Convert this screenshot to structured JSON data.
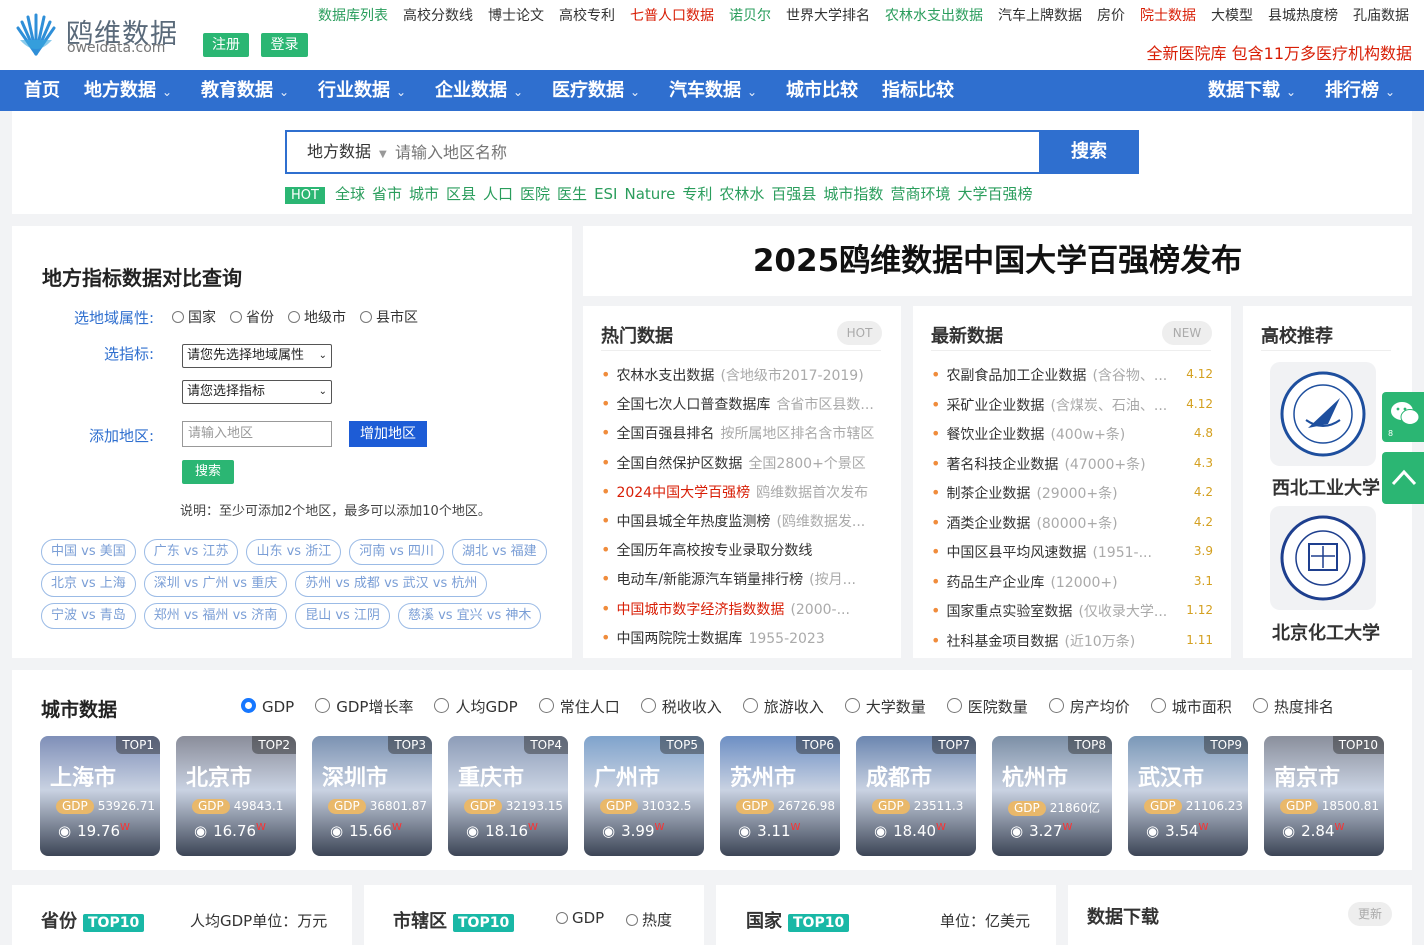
{
  "header": {
    "logo_cn": "鸥维数据",
    "logo_en": "oweidata.com",
    "register": "注册",
    "login": "登录",
    "links": [
      {
        "label": "数据库列表",
        "color": "green"
      },
      {
        "label": "高校分数线",
        "color": "normal"
      },
      {
        "label": "博士论文",
        "color": "normal"
      },
      {
        "label": "高校专利",
        "color": "normal"
      },
      {
        "label": "七普人口数据",
        "color": "red"
      },
      {
        "label": "诺贝尔",
        "color": "green"
      },
      {
        "label": "世界大学排名",
        "color": "normal"
      },
      {
        "label": "农林水支出数据",
        "color": "green"
      },
      {
        "label": "汽车上牌数据",
        "color": "normal"
      },
      {
        "label": "房价",
        "color": "normal"
      },
      {
        "label": "院士数据",
        "color": "red"
      },
      {
        "label": "大模型",
        "color": "normal"
      },
      {
        "label": "县城热度榜",
        "color": "normal"
      },
      {
        "label": "孔庙数据",
        "color": "normal"
      }
    ],
    "promo": "全新医院库 包含11万多医疗机构数据"
  },
  "nav": {
    "items": [
      "首页",
      "地方数据",
      "教育数据",
      "行业数据",
      "企业数据",
      "医疗数据",
      "汽车数据",
      "城市比较",
      "指标比较"
    ],
    "right_items": [
      "数据下载",
      "排行榜"
    ]
  },
  "search": {
    "category": "地方数据",
    "placeholder": "请输入地区名称",
    "button": "搜索",
    "hot_label": "HOT",
    "hot_links": [
      "全球",
      "省市",
      "城市",
      "区县",
      "人口",
      "医院",
      "医生",
      "ESI",
      "Nature",
      "专利",
      "农林水",
      "百强县",
      "城市指数",
      "营商环境",
      "大学百强榜"
    ]
  },
  "compare": {
    "title": "地方指标数据对比查询",
    "region_label": "选地域属性:",
    "region_options": [
      "国家",
      "省份",
      "地级市",
      "县市区"
    ],
    "indicator_label": "选指标:",
    "indicator_select1": "请您先选择地域属性",
    "indicator_select2": "请您选择指标",
    "add_label": "添加地区:",
    "add_placeholder": "请输入地区",
    "add_button": "增加地区",
    "search_button": "搜索",
    "note": "说明：至少可添加2个地区，最多可以添加10个地区。",
    "pills": [
      [
        "中国 vs 美国",
        "广东 vs 江苏",
        "山东 vs 浙江",
        "河南 vs 四川",
        "湖北 vs 福建"
      ],
      [
        "北京 vs 上海",
        "深圳 vs 广州 vs 重庆",
        "苏州 vs 成都 vs 武汉 vs 杭州"
      ],
      [
        "宁波 vs 青岛",
        "郑州 vs 福州 vs 济南",
        "昆山 vs 江阴",
        "慈溪 vs 宜兴 vs 神木"
      ]
    ]
  },
  "banner": {
    "text": "2025鸥维数据中国大学百强榜发布"
  },
  "hot_data": {
    "title": "热门数据",
    "badge": "HOT",
    "items": [
      {
        "t": "农林水支出数据",
        "sub": "(含地级市2017-2019)",
        "red": false
      },
      {
        "t": "全国七次人口普查数据库",
        "sub": "含省市区县数...",
        "red": false
      },
      {
        "t": "全国百强县排名",
        "sub": "按所属地区排名含市辖区",
        "red": false
      },
      {
        "t": "全国自然保护区数据",
        "sub": "全国2800+个景区",
        "red": false
      },
      {
        "t": "2024中国大学百强榜",
        "sub": "鸥维数据首次发布",
        "red": true
      },
      {
        "t": "中国县城全年热度监测榜",
        "sub": "(鸥维数据发...",
        "red": false
      },
      {
        "t": "全国历年高校按专业录取分数线",
        "sub": "",
        "red": false
      },
      {
        "t": "电动车/新能源汽车销量排行榜",
        "sub": "(按月...",
        "red": false
      },
      {
        "t": "中国城市数字经济指数数据",
        "sub": "(2000-...",
        "red": true
      },
      {
        "t": "中国两院院士数据库",
        "sub": "1955-2023",
        "red": false
      }
    ]
  },
  "new_data": {
    "title": "最新数据",
    "badge": "NEW",
    "items": [
      {
        "t": "农副食品加工企业数据",
        "sub": "(含谷物、...",
        "d": "4.12"
      },
      {
        "t": "采矿业企业数据",
        "sub": "(含煤炭、石油、...",
        "d": "4.12"
      },
      {
        "t": "餐饮业企业数据",
        "sub": "(400w+条)",
        "d": "4.8"
      },
      {
        "t": "著名科技企业数据",
        "sub": "(47000+条)",
        "d": "4.3"
      },
      {
        "t": "制茶企业数据",
        "sub": "(29000+条)",
        "d": "4.2"
      },
      {
        "t": "酒类企业数据",
        "sub": "(80000+条)",
        "d": "4.2"
      },
      {
        "t": "中国区县平均风速数据",
        "sub": "(1951-...",
        "d": "3.9"
      },
      {
        "t": "药品生产企业库",
        "sub": "(12000+)",
        "d": "3.1"
      },
      {
        "t": "国家重点实验室数据",
        "sub": "(仅收录大学...",
        "d": "1.12"
      },
      {
        "t": "社科基金项目数据",
        "sub": "(近10万条)",
        "d": "1.11"
      }
    ]
  },
  "universities": {
    "title": "高校推荐",
    "items": [
      "西北工业大学",
      "北京化工大学"
    ]
  },
  "city": {
    "title": "城市数据",
    "options": [
      "GDP",
      "GDP增长率",
      "人均GDP",
      "常住人口",
      "税收收入",
      "旅游收入",
      "大学数量",
      "医院数量",
      "房产均价",
      "城市面积",
      "热度排名"
    ],
    "selected": "GDP",
    "cards": [
      {
        "name": "上海市",
        "top": "TOP1",
        "gdp_label": "GDP",
        "gdp": "53926.71",
        "views": "19.76",
        "w": "W",
        "color": "#7f8fb8"
      },
      {
        "name": "北京市",
        "top": "TOP2",
        "gdp_label": "GDP",
        "gdp": "49843.1",
        "views": "16.76",
        "w": "W",
        "color": "#8a8d9a"
      },
      {
        "name": "深圳市",
        "top": "TOP3",
        "gdp_label": "GDP",
        "gdp": "36801.87",
        "views": "15.66",
        "w": "W",
        "color": "#7b92b2"
      },
      {
        "name": "重庆市",
        "top": "TOP4",
        "gdp_label": "GDP",
        "gdp": "32193.15",
        "views": "18.16",
        "w": "W",
        "color": "#8d9cb8"
      },
      {
        "name": "广州市",
        "top": "TOP5",
        "gdp_label": "GDP",
        "gdp": "31032.5",
        "views": "3.99",
        "w": "W",
        "color": "#7fa3cc"
      },
      {
        "name": "苏州市",
        "top": "TOP6",
        "gdp_label": "GDP",
        "gdp": "26726.98",
        "views": "3.11",
        "w": "W",
        "color": "#6d8fc4"
      },
      {
        "name": "成都市",
        "top": "TOP7",
        "gdp_label": "GDP",
        "gdp": "23511.3",
        "views": "18.40",
        "w": "W",
        "color": "#6b86b0"
      },
      {
        "name": "杭州市",
        "top": "TOP8",
        "gdp_label": "GDP",
        "gdp": "21860亿",
        "views": "3.27",
        "w": "W",
        "color": "#7c8fa6"
      },
      {
        "name": "武汉市",
        "top": "TOP9",
        "gdp_label": "GDP",
        "gdp": "21106.23",
        "views": "3.54",
        "w": "W",
        "color": "#7a98b8"
      },
      {
        "name": "南京市",
        "top": "TOP10",
        "gdp_label": "GDP",
        "gdp": "18500.81",
        "views": "2.84",
        "w": "W",
        "color": "#8a8f9c"
      }
    ]
  },
  "bottom": {
    "province_title": "省份",
    "province_badge": "TOP10",
    "province_unit": "人均GDP单位：万元",
    "district_title": "市辖区",
    "district_badge": "TOP10",
    "district_opt1": "GDP",
    "district_opt2": "热度",
    "country_title": "国家",
    "country_badge": "TOP10",
    "country_unit": "单位：亿美元",
    "download_title": "数据下载",
    "download_badge": "更新"
  },
  "side": {
    "wechat_count": "8"
  },
  "colors": {
    "primary": "#2f6fcf",
    "green": "#2bb673",
    "red": "#d81e06",
    "teal": "#19b8a6"
  }
}
